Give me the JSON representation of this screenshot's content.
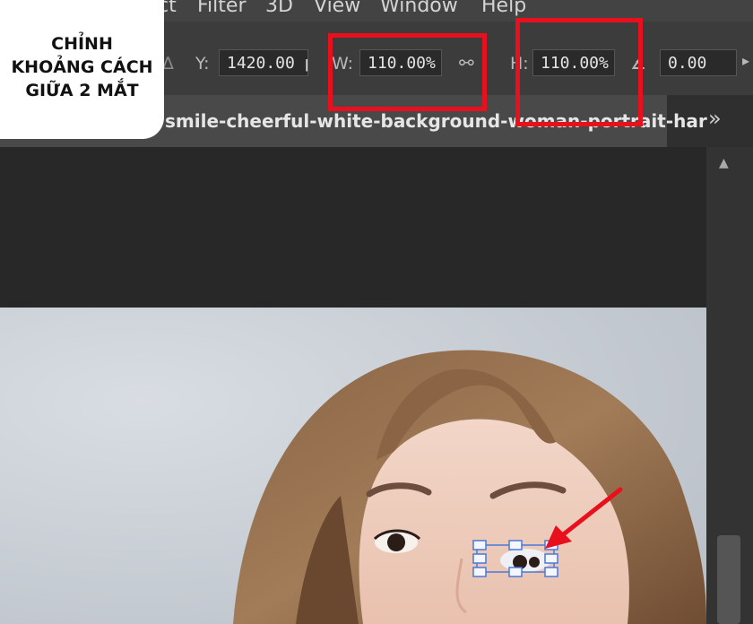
{
  "menu": {
    "items": [
      "ct",
      "Filter",
      "3D",
      "View",
      "Window",
      "Help"
    ]
  },
  "options_bar": {
    "y_label": "Y:",
    "y_value": "1420.00 p",
    "w_label": "W:",
    "w_value": "110.00%",
    "h_label": "H:",
    "h_value": "110.00%",
    "angle_value": "0.00"
  },
  "tab": {
    "title": "smile-cheerful-white-background-woman-portrait-har"
  },
  "badge": {
    "text": "CHỈNH\nKHOẢNG CÁCH\nGIỮA 2 MẮT"
  },
  "colors": {
    "highlight": "#e8101c",
    "arrow": "#e8101c",
    "transform_handle": "#4a78d8"
  }
}
